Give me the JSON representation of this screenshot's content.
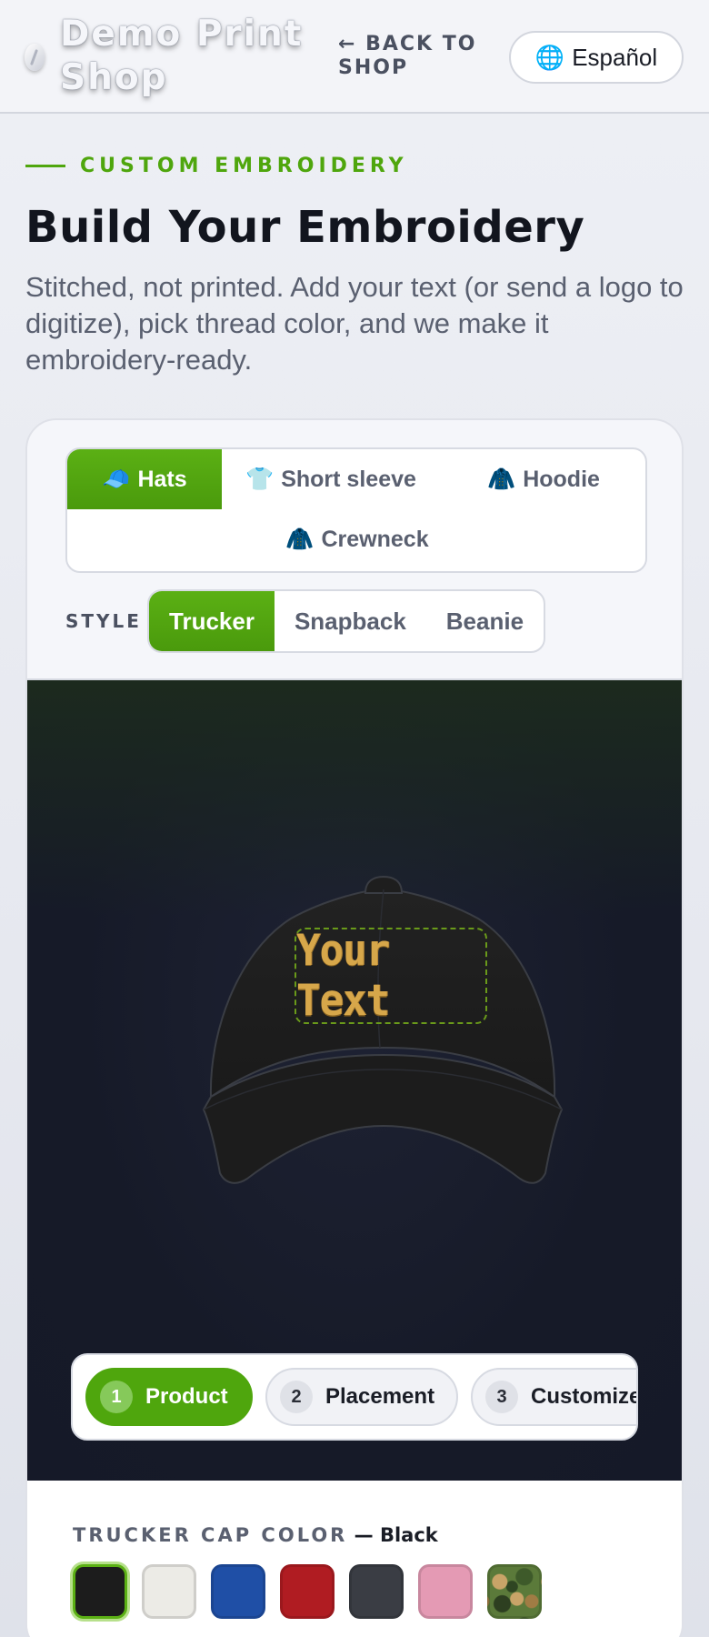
{
  "header": {
    "brand": "Demo Print Shop",
    "back_link": "← BACK TO SHOP",
    "language_button": "Español",
    "language_icon": "globe-icon"
  },
  "hero": {
    "eyebrow": "CUSTOM EMBROIDERY",
    "title": "Build Your Embroidery",
    "subtitle": "Stitched, not printed. Add your text (or send a logo to digitize), pick thread color, and we make it embroidery-ready."
  },
  "product_tabs": [
    {
      "label": "Hats",
      "icon": "🧢",
      "active": true
    },
    {
      "label": "Short sleeve",
      "icon": "👕",
      "active": false
    },
    {
      "label": "Hoodie",
      "icon": "🧥",
      "active": false
    },
    {
      "label": "Crewneck",
      "icon": "🧥",
      "active": false
    }
  ],
  "style": {
    "label": "STYLE",
    "options": [
      "Trucker",
      "Snapback",
      "Beanie"
    ],
    "selected": "Trucker"
  },
  "preview": {
    "embroidery_text": "Your Text",
    "thread_color": "#d7a74a",
    "cap_color": "#1c1c1c"
  },
  "steps": [
    {
      "number": "1",
      "label": "Product",
      "active": true
    },
    {
      "number": "2",
      "label": "Placement",
      "active": false
    },
    {
      "number": "3",
      "label": "Customize",
      "active": false
    }
  ],
  "cap_color": {
    "label": "TRUCKER CAP COLOR",
    "separator": " — ",
    "selected_name": "Black",
    "swatches": [
      {
        "name": "Black",
        "color": "#1c1c1c",
        "selected": true
      },
      {
        "name": "White",
        "color": "#ecebe6",
        "selected": false
      },
      {
        "name": "Royal Blue",
        "color": "#1f4fa6",
        "selected": false
      },
      {
        "name": "Red",
        "color": "#b01c22",
        "selected": false
      },
      {
        "name": "Charcoal",
        "color": "#3a3d44",
        "selected": false
      },
      {
        "name": "Pink",
        "color": "#e49ab4",
        "selected": false
      },
      {
        "name": "Camo",
        "color": "#5b7a3a",
        "selected": false
      }
    ]
  },
  "accent_color": "#4fa60d"
}
